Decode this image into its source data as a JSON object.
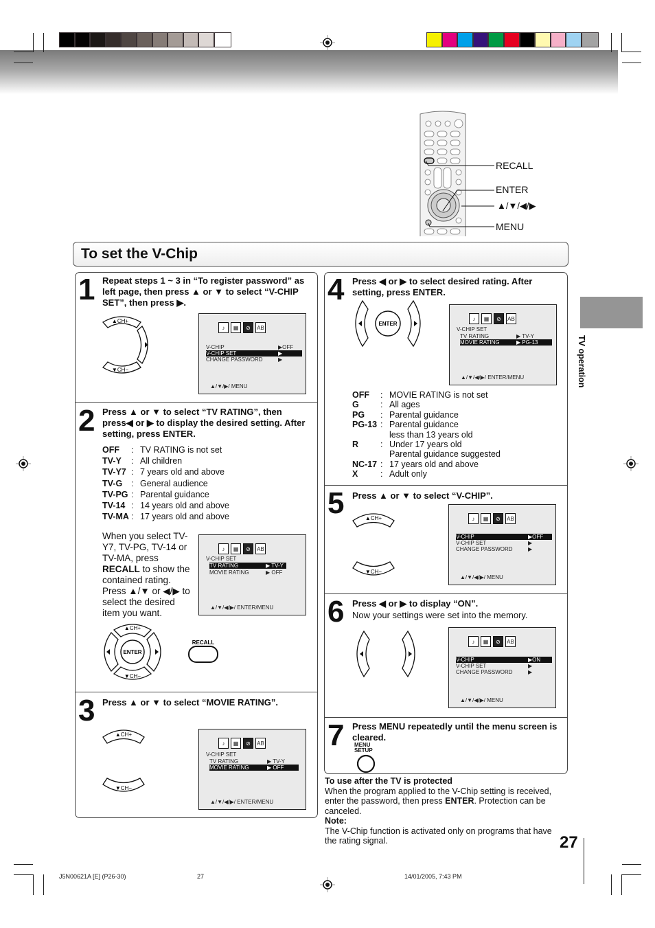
{
  "header": {
    "gray_swatches": [
      "#000000",
      "#050303",
      "#1c1816",
      "#352d2b",
      "#4f4643",
      "#6b615c",
      "#867c77",
      "#a49b96",
      "#c3bab6",
      "#ded8d5",
      "#ffffff"
    ],
    "color_swatches": [
      "#f6f000",
      "#e4007f",
      "#00a0e9",
      "#36127a",
      "#009a44",
      "#e60020",
      "#000000",
      "#fff9b0",
      "#f6b0c8",
      "#9fd3f2",
      "#a3a3a3"
    ]
  },
  "remote_callouts": {
    "recall": "RECALL",
    "enter": "ENTER",
    "arrows": "▲/▼/◀/▶",
    "menu": "MENU"
  },
  "section_title": "To set the V-Chip",
  "side_tab": {
    "label": "TV operation"
  },
  "steps": [
    {
      "num": "1",
      "text": "Repeat steps 1 ~ 3 in “To register password” as left page, then press ▲ or ▼ to select “V-CHIP SET”, then press ▶.",
      "buttons": {
        "up": "▲CH+",
        "down": "▼CH−",
        "right": "▶"
      },
      "osd": {
        "rows": [
          {
            "label": "V-CHIP",
            "value": "▶OFF",
            "highlight": false
          },
          {
            "label": "V-CHIP SET",
            "value": "▶",
            "highlight": true
          },
          {
            "label": "CHANGE PASSWORD",
            "value": "▶",
            "highlight": false
          }
        ],
        "footer": "▲/▼/▶/ MENU"
      }
    },
    {
      "num": "2",
      "text": "Press ▲ or ▼ to select “TV RATING”, then press◀ or ▶ to display the desired setting. After setting, press ENTER.",
      "ratings": [
        {
          "key": "OFF",
          "desc": "TV RATING is not set"
        },
        {
          "key": "TV-Y",
          "desc": "All children"
        },
        {
          "key": "TV-Y7",
          "desc": "7 years old and above"
        },
        {
          "key": "TV-G",
          "desc": "General audience"
        },
        {
          "key": "TV-PG",
          "desc": "Parental guidance"
        },
        {
          "key": "TV-14",
          "desc": "14 years old and above"
        },
        {
          "key": "TV-MA",
          "desc": "17 years old and above"
        }
      ],
      "note_pre": "When you select TV-Y7, TV-PG, TV-14 or TV-MA, press ",
      "note_bold": "RECALL",
      "note_post": " to show the contained rating. Press ▲/▼ or ◀/▶ to select the desired item you want.",
      "osd": {
        "heading": "V-CHIP SET",
        "rows": [
          {
            "label": "TV RATING",
            "value": "▶ TV-Y",
            "highlight": true
          },
          {
            "label": "MOVIE RATING",
            "value": "▶ OFF",
            "highlight": false
          }
        ],
        "footer": "▲/▼/◀/▶/ ENTER/MENU"
      },
      "buttons": {
        "up": "▲CH+",
        "down": "▼CH−",
        "enter": "ENTER",
        "recall": "RECALL"
      }
    },
    {
      "num": "3",
      "text": "Press ▲ or ▼ to select “MOVIE RATING”.",
      "buttons": {
        "up": "▲CH+",
        "down": "▼CH−"
      },
      "osd": {
        "heading": "V-CHIP SET",
        "rows": [
          {
            "label": "TV RATING",
            "value": "▶ TV-Y",
            "highlight": false
          },
          {
            "label": "MOVIE RATING",
            "value": "▶ OFF",
            "highlight": true
          }
        ],
        "footer": "▲/▼/◀/▶/ ENTER/MENU"
      }
    },
    {
      "num": "4",
      "text": "Press ◀ or ▶ to select desired rating. After setting, press ENTER.",
      "buttons": {
        "enter": "ENTER"
      },
      "osd": {
        "heading": "V-CHIP SET",
        "rows": [
          {
            "label": "TV RATING",
            "value": "▶ TV-Y",
            "highlight": false
          },
          {
            "label": "MOVIE RATING",
            "value": "▶ PG-13",
            "highlight": true
          }
        ],
        "footer": "▲/▼/◀/▶/ ENTER/MENU"
      },
      "ratings": [
        {
          "key": "OFF",
          "desc": "MOVIE RATING is not set"
        },
        {
          "key": "G",
          "desc": "All ages"
        },
        {
          "key": "PG",
          "desc": "Parental guidance"
        },
        {
          "key": "PG-13",
          "desc": "Parental guidance"
        },
        {
          "key": "",
          "desc": "less than 13 years old",
          "cont": true
        },
        {
          "key": "R",
          "desc": "Under 17 years old"
        },
        {
          "key": "",
          "desc": "Parental guidance suggested",
          "cont": true
        },
        {
          "key": "NC-17",
          "desc": "17 years old and above"
        },
        {
          "key": "X",
          "desc": "Adult only"
        }
      ]
    },
    {
      "num": "5",
      "text": "Press ▲ or ▼ to select “V-CHIP”.",
      "buttons": {
        "up": "▲CH+",
        "down": "▼CH−"
      },
      "osd": {
        "rows": [
          {
            "label": "V-CHIP",
            "value": "▶OFF",
            "highlight": true
          },
          {
            "label": "V-CHIP SET",
            "value": "▶",
            "highlight": false
          },
          {
            "label": "CHANGE PASSWORD",
            "value": "▶",
            "highlight": false
          }
        ],
        "footer": "▲/▼/◀/▶/ MENU"
      }
    },
    {
      "num": "6",
      "text": "Press ◀ or ▶ to display “ON”.",
      "subtext": "Now your settings were set into the memory.",
      "osd": {
        "rows": [
          {
            "label": "V-CHIP",
            "value": "▶ON",
            "highlight": true
          },
          {
            "label": "V-CHIP SET",
            "value": "▶",
            "highlight": false
          },
          {
            "label": "CHANGE PASSWORD",
            "value": "▶",
            "highlight": false
          }
        ],
        "footer": "▲/▼/◀/▶/ MENU"
      }
    },
    {
      "num": "7",
      "text": "Press MENU repeatedly until the menu screen is cleared.",
      "button_label_1": "MENU",
      "button_label_2": "SETUP"
    }
  ],
  "protected_note": {
    "heading": "To use after the TV is protected",
    "text_pre": "When the program applied to the V-Chip setting is received, enter the password, then press ",
    "text_bold": "ENTER",
    "text_post": ". Protection can be canceled.",
    "note_heading": "Note:",
    "note_text": "The V-Chip function is activated only on programs that have the rating signal."
  },
  "page_number": "27",
  "footer": {
    "doc_code": "J5N00621A [E] (P26-30)",
    "page": "27",
    "timestamp": "14/01/2005, 7:43 PM"
  }
}
